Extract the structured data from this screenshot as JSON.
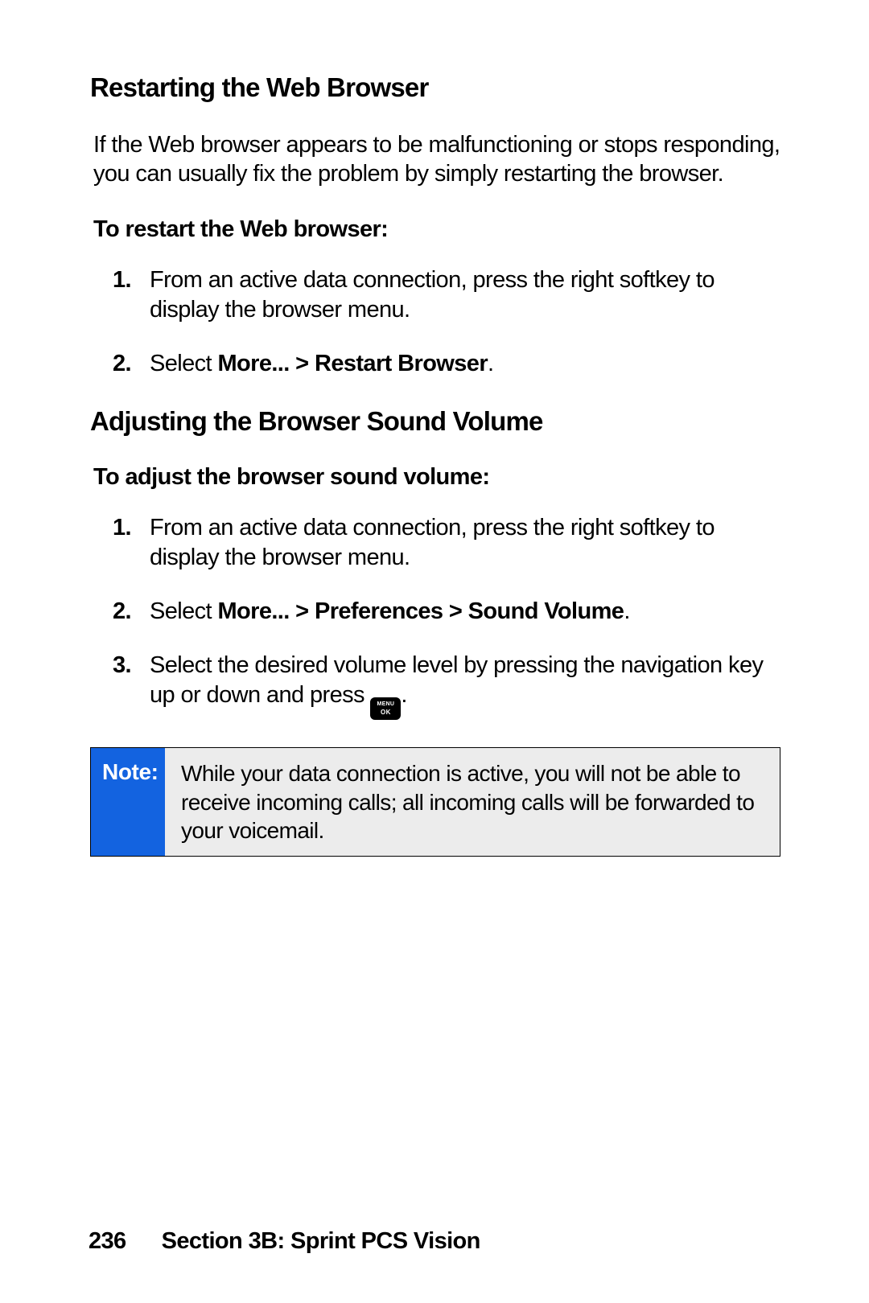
{
  "sec1": {
    "heading": "Restarting the Web Browser",
    "intro": "If the Web browser appears to be malfunctioning or stops responding, you can usually fix the problem by simply restarting the browser.",
    "subhead": "To restart the Web browser:",
    "steps": {
      "s1": "From an active data connection, press the right softkey to display the browser menu.",
      "s2_pre": "Select ",
      "s2_bold": "More... > Restart Browser",
      "s2_post": "."
    }
  },
  "sec2": {
    "heading": "Adjusting the Browser Sound Volume",
    "subhead": "To adjust the browser sound volume:",
    "steps": {
      "s1": "From an active data connection, press the right softkey to display the browser menu.",
      "s2_pre": "Select ",
      "s2_bold": "More... > Preferences > Sound Volume",
      "s2_post": ".",
      "s3_pre": "Select the desired volume level by pressing the navigation key up or down and press ",
      "s3_post": "."
    }
  },
  "icon": {
    "line1": "MENU",
    "line2": "OK"
  },
  "note": {
    "label": "Note:",
    "body": "While your data connection is active, you will not be able to receive incoming calls; all incoming calls will be forwarded to your voicemail."
  },
  "footer": {
    "page": "236",
    "section": "Section 3B: Sprint PCS Vision"
  }
}
